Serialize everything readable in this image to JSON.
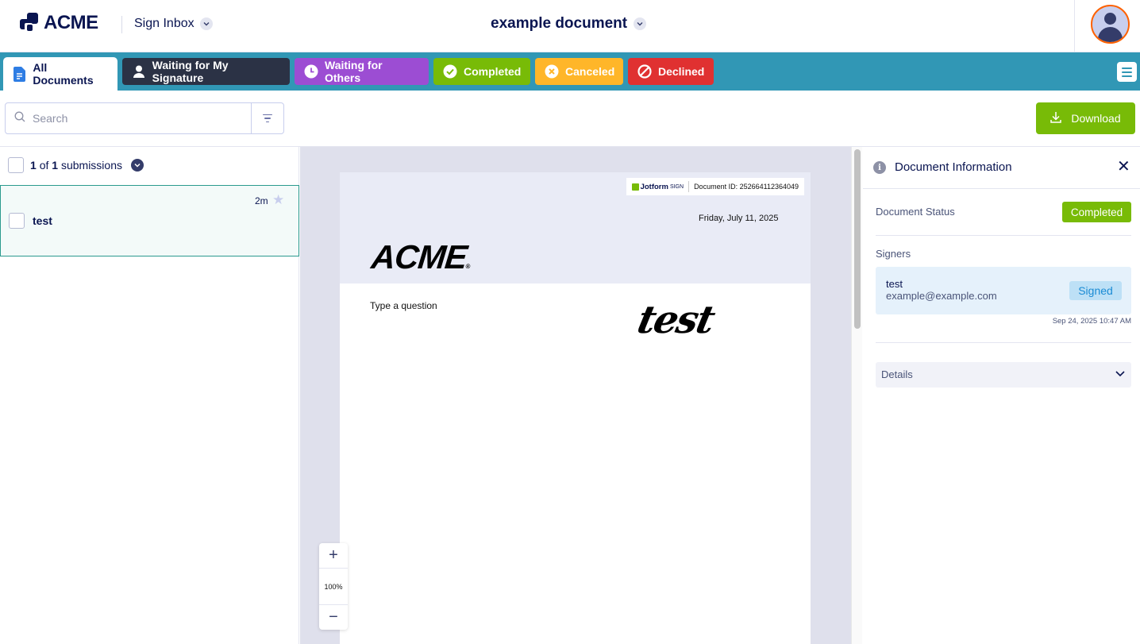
{
  "header": {
    "brand": "ACME",
    "inbox_label": "Sign Inbox",
    "document_title": "example document"
  },
  "tabs": [
    {
      "label": "All Documents",
      "icon": "document-icon",
      "active": true
    },
    {
      "label": "Waiting for My Signature",
      "icon": "person-icon",
      "color": "#2b3245"
    },
    {
      "label": "Waiting for Others",
      "icon": "clock-icon",
      "color": "#9c4dd3"
    },
    {
      "label": "Completed",
      "icon": "check-circle-icon",
      "color": "#78bb07"
    },
    {
      "label": "Canceled",
      "icon": "x-circle-icon",
      "color": "#ffb629"
    },
    {
      "label": "Declined",
      "icon": "prohibited-icon",
      "color": "#e03131"
    }
  ],
  "toolbar": {
    "search_placeholder": "Search",
    "download_label": "Download"
  },
  "list": {
    "count_current": "1",
    "count_of": "of",
    "count_total": "1",
    "count_suffix": "submissions",
    "items": [
      {
        "name": "test",
        "time": "2m"
      }
    ]
  },
  "document": {
    "provider": "Jotform",
    "provider_suffix": "SIGN",
    "doc_id": "Document ID: 252664112364049",
    "date": "Friday, July 11, 2025",
    "brand": "ACME",
    "brand_mark": "®",
    "question": "Type a question",
    "signature": "test",
    "zoom": "100%"
  },
  "info_panel": {
    "title": "Document Information",
    "status_label": "Document Status",
    "status_value": "Completed",
    "signers_label": "Signers",
    "signer": {
      "name": "test",
      "email": "example@example.com",
      "status": "Signed",
      "date": "Sep 24, 2025 10:47 AM"
    },
    "details_label": "Details"
  },
  "colors": {
    "tabs_bar": "#3197b5",
    "accent_green": "#78bb07",
    "navy": "#0a1551"
  }
}
